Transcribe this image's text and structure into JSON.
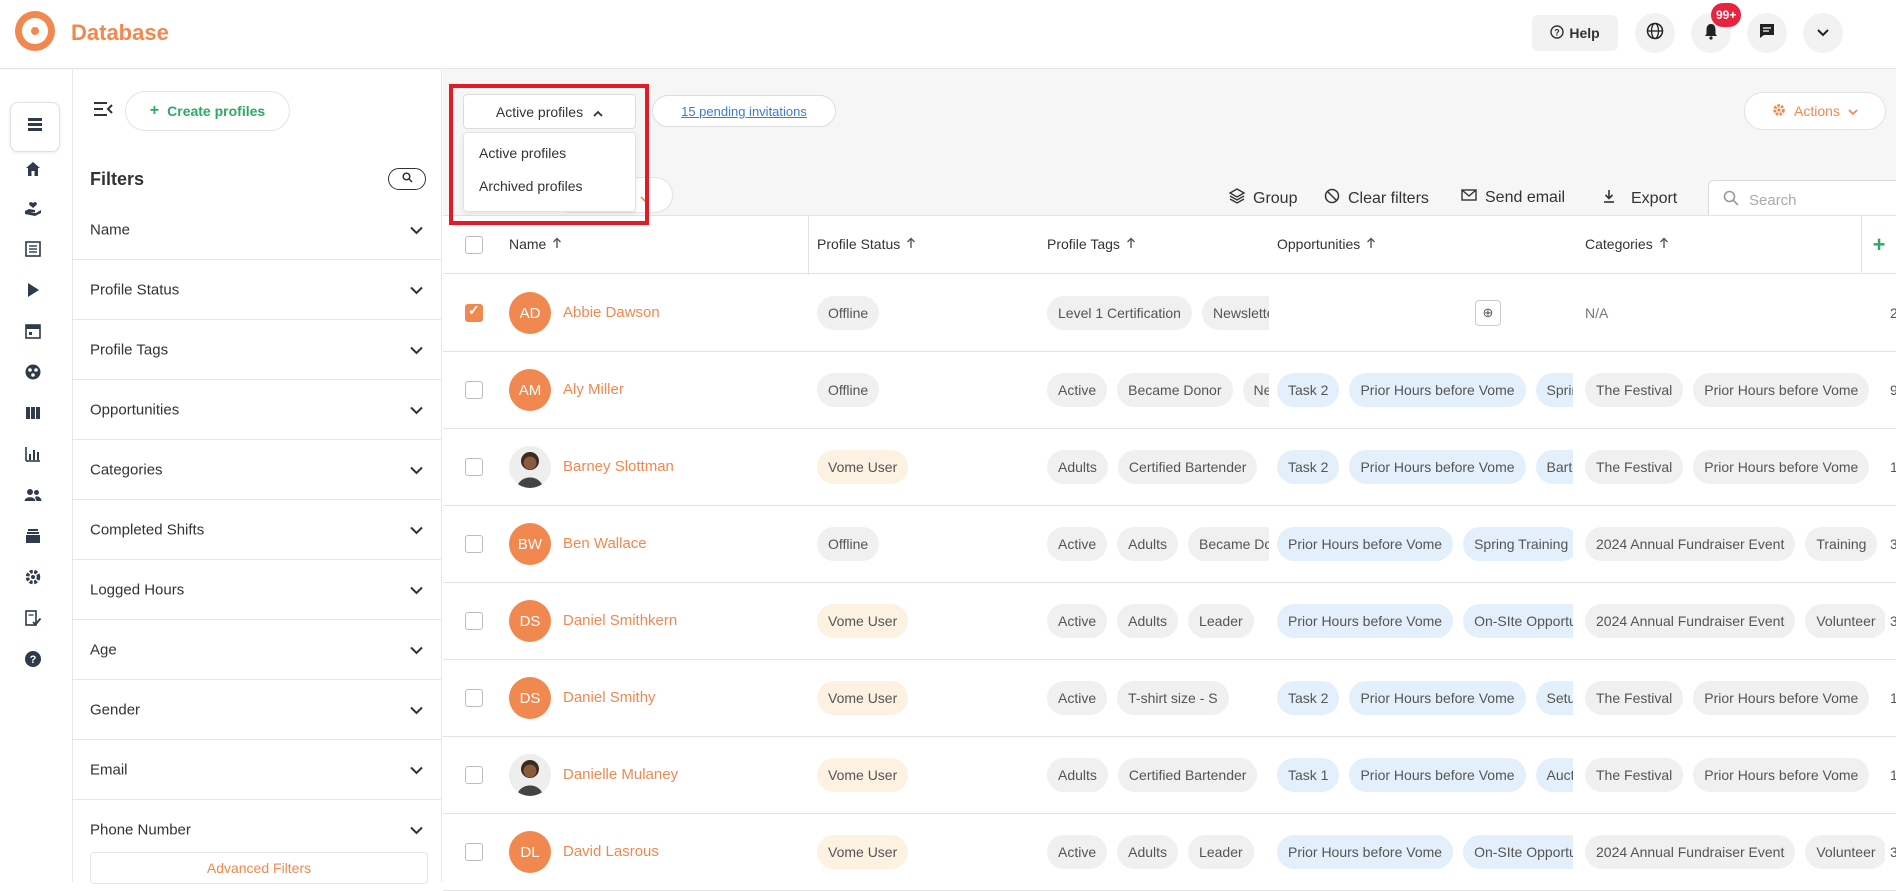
{
  "app": {
    "title": "Database"
  },
  "header": {
    "help_label": "Help",
    "notification_count": "99+"
  },
  "rail": {
    "items": [
      "database-icon",
      "home-icon",
      "donate-hand-icon",
      "list-icon",
      "play-icon",
      "calendar-icon",
      "group-icon",
      "board-icon",
      "chart-icon",
      "people-icon",
      "inbox-icon",
      "gear-icon",
      "checklist-icon",
      "help-icon"
    ]
  },
  "filters": {
    "create_label": "Create profiles",
    "title": "Filters",
    "items": [
      "Name",
      "Profile Status",
      "Profile Tags",
      "Opportunities",
      "Categories",
      "Completed Shifts",
      "Logged Hours",
      "Age",
      "Gender",
      "Email",
      "Phone Number"
    ],
    "advanced_label": "Advanced Filters"
  },
  "main": {
    "status_select": "Active profiles",
    "dropdown_options": [
      "Active profiles",
      "Archived profiles"
    ],
    "pending_link": "15 pending invitations",
    "actions_label": "Actions",
    "toolbar": {
      "group": "Group",
      "clear_filters": "Clear filters",
      "send_email": "Send email",
      "export": "Export",
      "search_placeholder": "Search"
    },
    "columns": [
      "Name",
      "Profile Status",
      "Profile Tags",
      "Opportunities",
      "Categories"
    ]
  },
  "rows": [
    {
      "initials": "AD",
      "name": "Abbie Dawson",
      "status": "Offline",
      "status_kind": "offline",
      "checked": true,
      "photo": false,
      "tags": [
        "Level 1 Certification",
        "Newsletter"
      ],
      "opps": [],
      "cats": [],
      "na": "N/A",
      "edge": "2"
    },
    {
      "initials": "AM",
      "name": "Aly Miller",
      "status": "Offline",
      "status_kind": "offline",
      "checked": false,
      "photo": false,
      "tags": [
        "Active",
        "Became Donor",
        "Newsletter"
      ],
      "opps": [
        "Task 2",
        "Prior Hours before Vome",
        "Spring Training"
      ],
      "cats": [
        "The Festival",
        "Prior Hours before Vome"
      ],
      "edge": "9"
    },
    {
      "initials": "",
      "name": "Barney Slottman",
      "status": "Vome User",
      "status_kind": "vome",
      "checked": false,
      "photo": true,
      "tags": [
        "Adults",
        "Certified Bartender"
      ],
      "opps": [
        "Task 2",
        "Prior Hours before Vome",
        "Bartender"
      ],
      "cats": [
        "The Festival",
        "Prior Hours before Vome"
      ],
      "edge": "1"
    },
    {
      "initials": "BW",
      "name": "Ben Wallace",
      "status": "Offline",
      "status_kind": "offline",
      "checked": false,
      "photo": false,
      "tags": [
        "Active",
        "Adults",
        "Became Donor"
      ],
      "opps": [
        "Prior Hours before Vome",
        "Spring Training"
      ],
      "cats": [
        "2024 Annual Fundraiser Event",
        "Training"
      ],
      "edge": "3"
    },
    {
      "initials": "DS",
      "name": "Daniel Smithkern",
      "status": "Vome User",
      "status_kind": "vome",
      "checked": false,
      "photo": false,
      "tags": [
        "Active",
        "Adults",
        "Leader"
      ],
      "opps": [
        "Prior Hours before Vome",
        "On-SIte Opportunity"
      ],
      "cats": [
        "2024 Annual Fundraiser Event",
        "Volunteer"
      ],
      "edge": "3"
    },
    {
      "initials": "DS",
      "name": "Daniel Smithy",
      "status": "Vome User",
      "status_kind": "vome",
      "checked": false,
      "photo": false,
      "tags": [
        "Active",
        "T-shirt size - S"
      ],
      "opps": [
        "Task 2",
        "Prior Hours before Vome",
        "Setup"
      ],
      "cats": [
        "The Festival",
        "Prior Hours before Vome"
      ],
      "edge": "1"
    },
    {
      "initials": "",
      "name": "Danielle Mulaney",
      "status": "Vome User",
      "status_kind": "vome",
      "checked": false,
      "photo": true,
      "tags": [
        "Adults",
        "Certified Bartender"
      ],
      "opps": [
        "Task 1",
        "Prior Hours before Vome",
        "Auction"
      ],
      "cats": [
        "The Festival",
        "Prior Hours before Vome"
      ],
      "edge": "1"
    },
    {
      "initials": "DL",
      "name": "David Lasrous",
      "status": "Vome User",
      "status_kind": "vome",
      "checked": false,
      "photo": false,
      "tags": [
        "Active",
        "Adults",
        "Leader"
      ],
      "opps": [
        "Prior Hours before Vome",
        "On-SIte Opportunity"
      ],
      "cats": [
        "2024 Annual Fundraiser Event",
        "Volunteer"
      ],
      "edge": "3"
    }
  ]
}
